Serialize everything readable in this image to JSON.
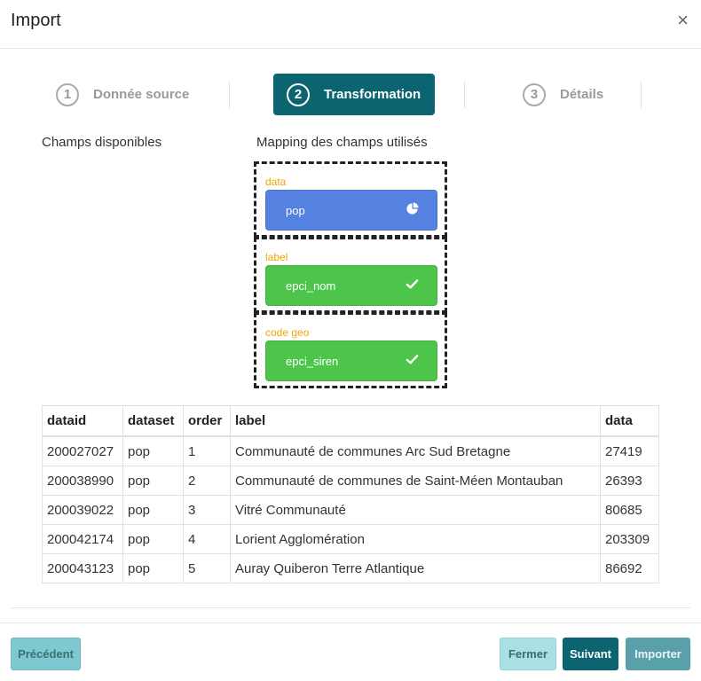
{
  "dialog": {
    "title": "Import",
    "close_symbol": "×"
  },
  "steps": [
    {
      "number": "1",
      "label": "Donnée source",
      "active": false
    },
    {
      "number": "2",
      "label": "Transformation",
      "active": true
    },
    {
      "number": "3",
      "label": "Détails",
      "active": false
    }
  ],
  "columns": {
    "available": "Champs disponibles",
    "mapping": "Mapping des champs utilisés"
  },
  "mapping": [
    {
      "slot_label": "data",
      "field": "pop",
      "icon": "pie-chart-icon",
      "color": "#5582e0"
    },
    {
      "slot_label": "label",
      "field": "epci_nom",
      "icon": "check-icon",
      "color": "#4dc54a"
    },
    {
      "slot_label": "code geo",
      "field": "epci_siren",
      "icon": "check-icon",
      "color": "#4dc54a"
    }
  ],
  "table": {
    "headers": [
      "dataid",
      "dataset",
      "order",
      "label",
      "data"
    ],
    "rows": [
      [
        "200027027",
        "pop",
        "1",
        "Communauté de communes Arc Sud Bretagne",
        "27419"
      ],
      [
        "200038990",
        "pop",
        "2",
        "Communauté de communes de Saint-Méen Montauban",
        "26393"
      ],
      [
        "200039022",
        "pop",
        "3",
        "Vitré Communauté",
        "80685"
      ],
      [
        "200042174",
        "pop",
        "4",
        "Lorient Agglomération",
        "203309"
      ],
      [
        "200043123",
        "pop",
        "5",
        "Auray Quiberon Terre Atlantique",
        "86692"
      ]
    ]
  },
  "footer": {
    "previous": "Précédent",
    "close": "Fermer",
    "next": "Suivant",
    "import": "Importer"
  },
  "colors": {
    "primary": "#0b6470",
    "slot_label": "#f0a500"
  }
}
